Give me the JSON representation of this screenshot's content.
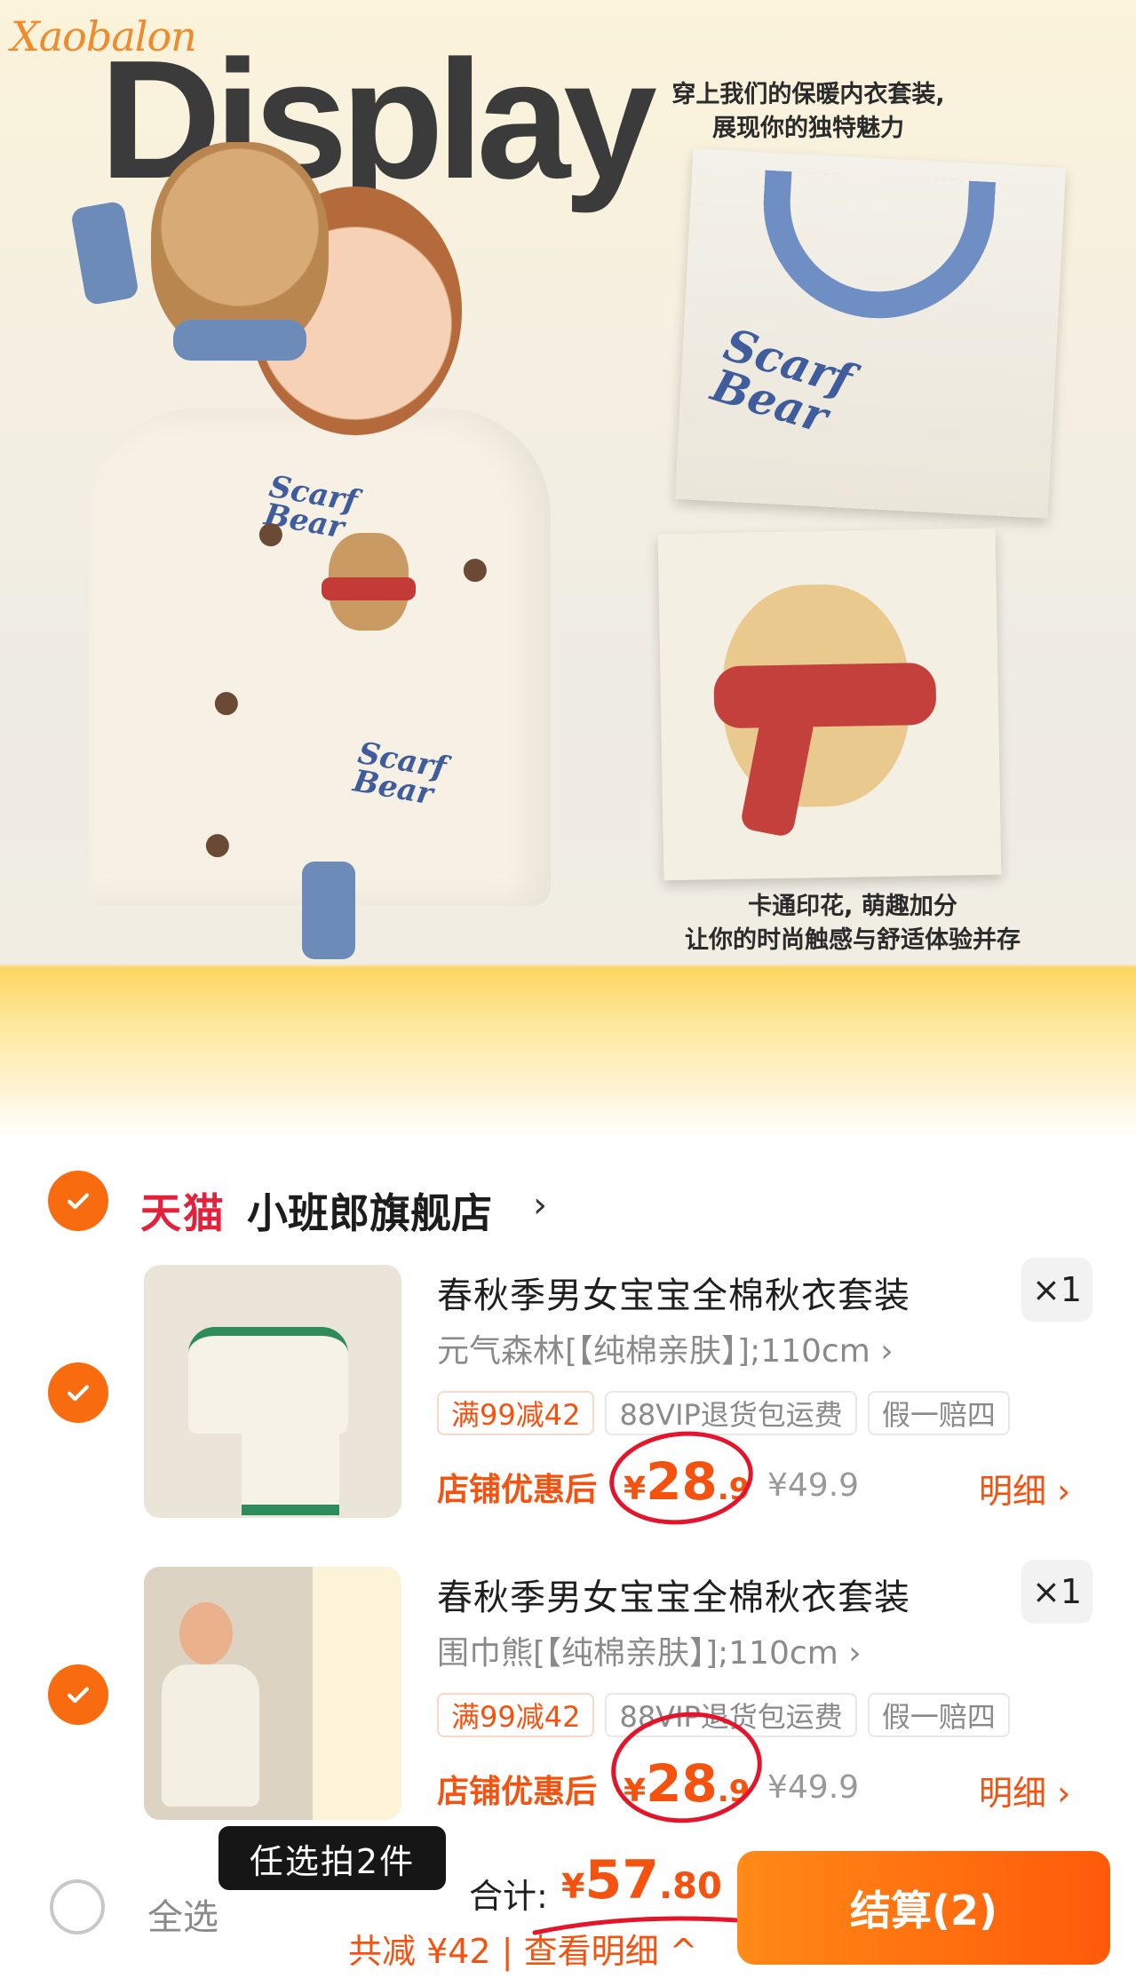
{
  "banner": {
    "brand": "Xaobalon",
    "title": "Display",
    "caption_top_line1": "穿上我们的保暖内衣套装,",
    "caption_top_line2": "展现你的独特魅力",
    "caption_bottom_line1": "卡通印花, 萌趣加分",
    "caption_bottom_line2": "让你的时尚触感与舒适体验并存",
    "print_text_line1": "Scarf",
    "print_text_line2": "Bear"
  },
  "store": {
    "platform": "天猫",
    "name": "小班郎旗舰店",
    "arrow": "›"
  },
  "items": [
    {
      "title": "春秋季男女宝宝全棉秋衣套装",
      "quantity": "×1",
      "sku": "元气森林[【纯棉亲肤】];110cm ›",
      "tags": [
        "满99减42",
        "88VIP退货包运费",
        "假一赔四"
      ],
      "price_label": "店铺优惠后",
      "price_symbol": "¥",
      "price_int": "28",
      "price_dec": ".9",
      "original_price": "¥49.9",
      "detail_link": "明细 ›"
    },
    {
      "title": "春秋季男女宝宝全棉秋衣套装",
      "quantity": "×1",
      "sku": "围巾熊[【纯棉亲肤】];110cm ›",
      "tags": [
        "满99减42",
        "88VIP退货包运费",
        "假一赔四"
      ],
      "price_label": "店铺优惠后",
      "price_symbol": "¥",
      "price_int": "28",
      "price_dec": ".9",
      "original_price": "¥49.9",
      "detail_link": "明细 ›"
    }
  ],
  "bottom_bar": {
    "tooltip": "任选拍2件",
    "select_all": "全选",
    "total_label": "合计:",
    "total_symbol": "¥",
    "total_int": "57",
    "total_dec": ".80",
    "discount_text": "共减 ¥42 | 查看明细 ^",
    "checkout_label": "结算(2)"
  },
  "colors": {
    "accent": "#f5520f",
    "checkout_gradient_start": "#ff8a16",
    "checkout_gradient_end": "#ff5a0a",
    "tmall_red": "#e4203a",
    "annotation_red": "#e4152a"
  }
}
